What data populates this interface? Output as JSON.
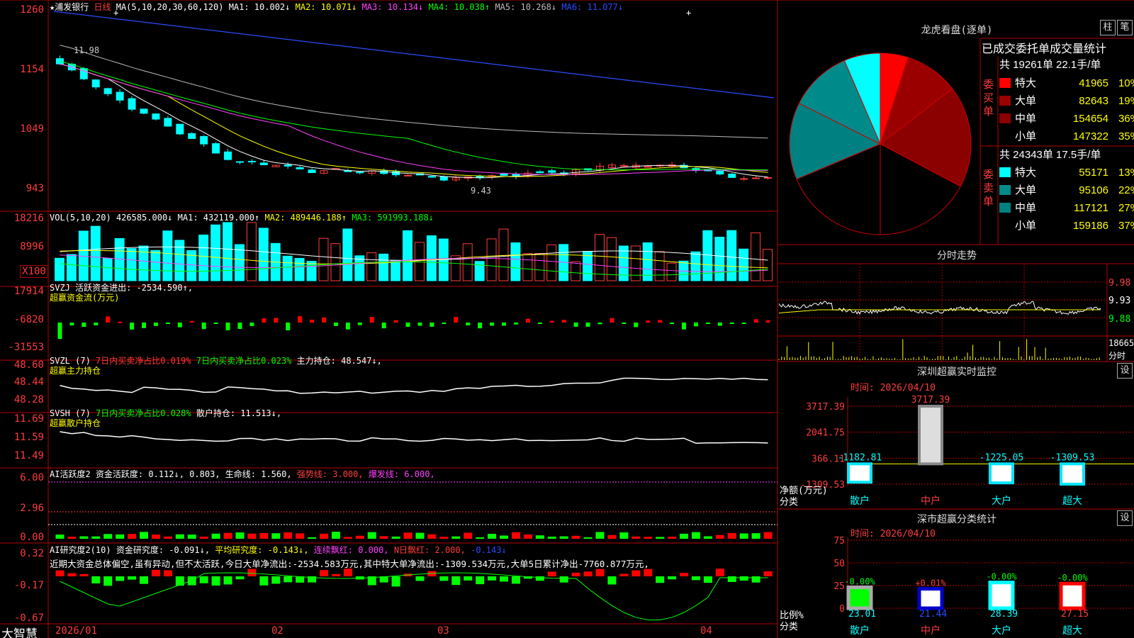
{
  "colors": {
    "up": "#ff3c3c",
    "down": "#00ffff",
    "grid": "#b40000",
    "ma1": "#ffffff",
    "ma2": "#ffff00",
    "ma3": "#ff40ff",
    "ma4": "#00ff00",
    "ma5": "#bbbbbb",
    "ma6": "#2a4bff"
  },
  "kline": {
    "star": "★",
    "stock_name": "浦发银行",
    "period": "日线",
    "ma_params": "MA(5,10,20,30,60,120)",
    "ma1": "MA1: 10.002↓",
    "ma2": "MA2: 10.071↓",
    "ma3": "MA3: 10.134↓",
    "ma4": "MA4: 10.038↑",
    "ma5": "MA5: 10.268↓",
    "ma6": "MA6: 11.077↓",
    "y_ticks": [
      "1260",
      "1154",
      "1049",
      "943"
    ],
    "high_label": "11.98",
    "low_label": "9.43"
  },
  "vol": {
    "params": "VOL(5,10,20)",
    "value": "426585.000↓",
    "ma1": "MA1: 432119.000↑",
    "ma2": "MA2: 489446.188↑",
    "ma3": "MA3: 591993.188↓",
    "y_ticks": [
      "18216",
      "8996"
    ],
    "unit": "X100"
  },
  "svzj": {
    "line1": "SVZJ  活跃资金进出: -2534.590↑,",
    "line2": "超赢资金流(万元)",
    "y_ticks": [
      "17914",
      "-6820",
      "-31553"
    ]
  },
  "svzl": {
    "name": "SVZL (7)",
    "a": "7日内买卖净占比0.019%",
    "b": "7日内买卖净占比0.023%",
    "c": "主力持仓: 48.547↓,",
    "line2": "超赢主力持仓",
    "y_ticks": [
      "48.60",
      "48.44",
      "48.28"
    ]
  },
  "svsh": {
    "name": "SVSH (7)",
    "a": "7日内买卖净占比0.028%",
    "c": "散户持仓: 11.513↓,",
    "line2": "超赢散户持仓",
    "y_ticks": [
      "11.69",
      "11.59",
      "11.49"
    ]
  },
  "ai1": {
    "name": "AI活跃度2",
    "a": "资金活跃度: 0.112↓, 0.803,",
    "b": "生命线: 1.560,",
    "c": "强势线: 3.000,",
    "d": "爆发线: 6.000,",
    "y_ticks": [
      "6.00",
      "2.96",
      "0.00"
    ]
  },
  "ai2": {
    "name": "AI研究度2(10)",
    "a": "资金研究度: -0.091↓,",
    "b": "平均研究度: -0.143↓,",
    "c": "连续飘红: 0.000,",
    "d": "N日飘红: 2.000,",
    "e": "-0.143↓",
    "comment": "近期大资金总体偏空,虽有异动,但不太活跃,今日大单净流出:-2534.583万元,其中特大单净流出:-1309.534万元,大单5日累计净出-7760.877万元,",
    "y_ticks": [
      "0.32",
      "-0.17",
      "-0.67"
    ]
  },
  "xaxis": {
    "brand": "大智慧",
    "labels": [
      "2026/01",
      "02",
      "03",
      "04"
    ]
  },
  "longhu": {
    "title": "龙虎看盘(逐单)",
    "btn_col": "柱",
    "btn_pen": "笔",
    "header": "已成交委托单成交量统计",
    "buy_label": "委买单",
    "sell_label": "委卖单",
    "buy_total": "共 19261单 22.1手/单",
    "sell_total": "共 24343单 17.5手/单",
    "buy_rows": [
      {
        "name": "特大",
        "vol": "41965",
        "pct": "10%",
        "color": "#ff0000"
      },
      {
        "name": "大单",
        "vol": "82643",
        "pct": "19%",
        "color": "#9a0000"
      },
      {
        "name": "中单",
        "vol": "154654",
        "pct": "36%",
        "color": "#8b0000"
      },
      {
        "name": "小单",
        "vol": "147322",
        "pct": "35%",
        "color": "#000000"
      }
    ],
    "sell_rows": [
      {
        "name": "特大",
        "vol": "55171",
        "pct": "13%",
        "color": "#00ffff"
      },
      {
        "name": "大单",
        "vol": "95106",
        "pct": "22%",
        "color": "#008b8b"
      },
      {
        "name": "中单",
        "vol": "117121",
        "pct": "27%",
        "color": "#008080"
      },
      {
        "name": "小单",
        "vol": "159186",
        "pct": "37%",
        "color": "#000000"
      }
    ]
  },
  "intraday": {
    "title": "分时走势",
    "prices": [
      "9.98",
      "9.93",
      "9.88"
    ],
    "vol_top": "18665",
    "vol_unit": "分时"
  },
  "monitor": {
    "title": "深圳超赢实时监控",
    "settings": "设",
    "time": "时间: 2026/04/10",
    "y_ticks": [
      "3717.39",
      "2041.75",
      "366.11",
      "-1309.53"
    ],
    "ylabel1": "净额(万元)",
    "ylabel2": "分类",
    "categories": [
      "散户",
      "中户",
      "大户",
      "超大"
    ],
    "values": [
      -1182.81,
      3717.39,
      -1225.05,
      -1309.53
    ],
    "value_labels": [
      "-1182.81",
      "3717.39",
      "-1225.05",
      "-1309.53"
    ]
  },
  "classify": {
    "title": "深市超赢分类统计",
    "settings": "设",
    "time": "时间: 2026/04/10",
    "y_ticks": [
      "75",
      "50",
      "25",
      "0"
    ],
    "ylabel1": "比例%",
    "ylabel2": "分类",
    "categories": [
      "散户",
      "中户",
      "大户",
      "超大"
    ],
    "values": [
      23.01,
      21.44,
      28.39,
      27.15
    ],
    "value_labels": [
      "23.01",
      "21.44",
      "28.39",
      "27.15"
    ],
    "change_labels": [
      "-0.00%",
      "+0.01%",
      "-0.00%",
      "-0.00%"
    ]
  }
}
